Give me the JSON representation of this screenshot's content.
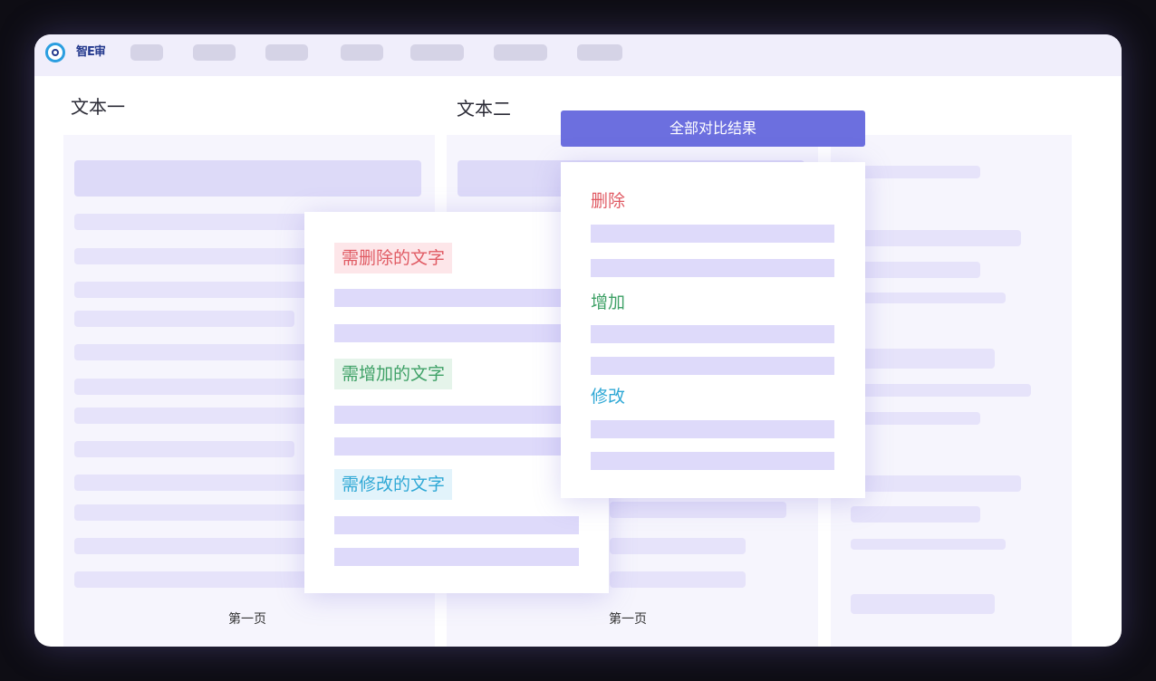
{
  "app": {
    "logo_text": "智E审"
  },
  "columns": {
    "text1_title": "文本一",
    "text2_title": "文本二"
  },
  "pages": {
    "left_label": "第一页",
    "middle_label": "第一页"
  },
  "overlay": {
    "delete_tag": "需删除的文字",
    "add_tag": "需增加的文字",
    "modify_tag": "需修改的文字"
  },
  "results": {
    "header": "全部对比结果",
    "delete_label": "删除",
    "add_label": "增加",
    "modify_label": "修改"
  },
  "colors": {
    "accent": "#6c6fdf",
    "delete": "#e05a63",
    "add": "#3fa167",
    "modify": "#2fa8d5"
  }
}
